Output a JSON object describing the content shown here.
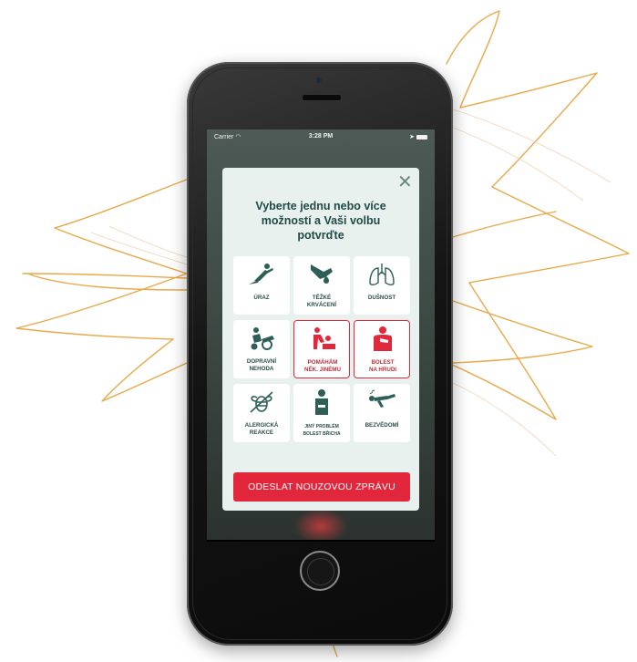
{
  "colors": {
    "accent_red": "#e2263b",
    "teal": "#2e5e58",
    "modal_bg": "#e8f1ee",
    "scribble": "#e8a94a"
  },
  "status_bar": {
    "carrier": "Carrier",
    "time": "3:28 PM"
  },
  "modal": {
    "title_lines": [
      "Vyberte jednu nebo více",
      "možností a Vaši volbu",
      "potvrďte"
    ],
    "close_label": "✕",
    "options": [
      {
        "label_lines": [
          "ÚRAZ"
        ],
        "icon": "fall-injury-icon",
        "selected": false
      },
      {
        "label_lines": [
          "TĚŽKÉ",
          "KRVÁCENÍ"
        ],
        "icon": "bleeding-hand-icon",
        "selected": false
      },
      {
        "label_lines": [
          "DUŠNOST"
        ],
        "icon": "lungs-icon",
        "selected": false
      },
      {
        "label_lines": [
          "DOPRAVNÍ",
          "NEHODA"
        ],
        "icon": "traffic-accident-icon",
        "selected": false
      },
      {
        "label_lines": [
          "POMÁHÁM",
          "NĚK. JINÉMU"
        ],
        "icon": "helping-person-icon",
        "selected": true
      },
      {
        "label_lines": [
          "BOLEST",
          "NA HRUDI"
        ],
        "icon": "chest-pain-icon",
        "selected": true
      },
      {
        "label_lines": [
          "ALERGICKÁ",
          "REAKCE"
        ],
        "icon": "bee-allergy-icon",
        "selected": false
      },
      {
        "label_lines": [
          "JINÝ PROBLÉM",
          "BOLEST BŘICHA"
        ],
        "icon": "stomach-pain-icon",
        "selected": false
      },
      {
        "label_lines": [
          "BEZVĚDOMÍ"
        ],
        "icon": "unconscious-person-icon",
        "selected": false
      }
    ],
    "send_button": "ODESLAT NOUZOVOU ZPRÁVU"
  }
}
